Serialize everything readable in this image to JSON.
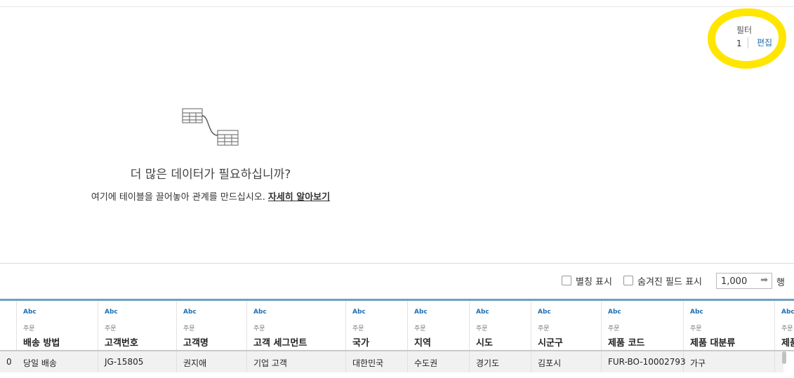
{
  "filter": {
    "title": "필터",
    "count": "1",
    "edit_label": "편집"
  },
  "canvas": {
    "need_more_text": "더 많은 데이터가 필요하십니까?",
    "drag_hint_text": "여기에 테이블을 끌어놓아 관계를 만드십시오.",
    "learn_more_label": "자세히 알아보기"
  },
  "options": {
    "show_aliases_label": "별칭 표시",
    "show_hidden_fields_label": "숨겨진 필드 표시",
    "rows_value": "1,000",
    "rows_label": "행"
  },
  "grid": {
    "columns": [
      {
        "type": "Abc",
        "source": "주문",
        "name": "배송 방법"
      },
      {
        "type": "Abc",
        "source": "주문",
        "name": "고객번호"
      },
      {
        "type": "Abc",
        "source": "주문",
        "name": "고객명"
      },
      {
        "type": "Abc",
        "source": "주문",
        "name": "고객 세그먼트"
      },
      {
        "type": "Abc",
        "source": "주문",
        "name": "국가"
      },
      {
        "type": "Abc",
        "source": "주문",
        "name": "지역"
      },
      {
        "type": "Abc",
        "source": "주문",
        "name": "시도"
      },
      {
        "type": "Abc",
        "source": "주문",
        "name": "시군구"
      },
      {
        "type": "Abc",
        "source": "주문",
        "name": "제품 코드"
      },
      {
        "type": "Abc",
        "source": "주문",
        "name": "제품 대분류"
      },
      {
        "type": "Abc",
        "source": "주문",
        "name": "제품"
      }
    ],
    "row_number": "0",
    "rows": [
      [
        "당일 배송",
        "JG-15805",
        "권지애",
        "기업 고객",
        "대한민국",
        "수도권",
        "경기도",
        "김포시",
        "FUR-BO-10002793",
        "가구",
        ""
      ]
    ]
  }
}
